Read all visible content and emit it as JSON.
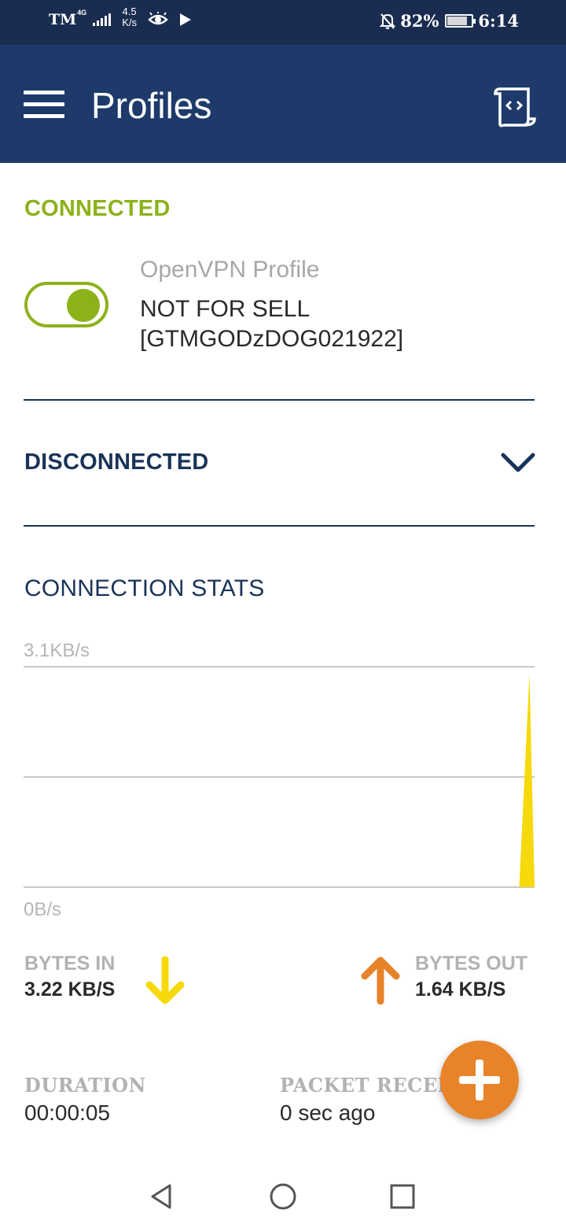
{
  "status_bar": {
    "carrier": "TM",
    "network_type": "4G",
    "net_speed_value": "4.5",
    "net_speed_unit": "K/s",
    "battery_percent": "82%",
    "battery_level": 0.82,
    "time": "6:14",
    "icons": [
      "signal-icon",
      "eye-icon",
      "play-icon",
      "bell-off-icon",
      "battery-icon"
    ]
  },
  "app_bar": {
    "title": "Profiles",
    "menu_icon": "hamburger-menu-icon",
    "action_icon": "import-file-icon",
    "background": "#1d3a6a"
  },
  "connected_section": {
    "label": "CONNECTED",
    "color": "#8cb21a",
    "toggle_on": true,
    "profile_type": "OpenVPN Profile",
    "profile_name": "NOT FOR SELL [GTMGODzDOG021922]"
  },
  "disconnected_section": {
    "label": "DISCONNECTED",
    "expand_icon": "chevron-down-icon"
  },
  "stats": {
    "title": "CONNECTION STATS",
    "bytes_in_label": "BYTES IN",
    "bytes_in_value": "3.22 KB/S",
    "bytes_out_label": "BYTES OUT",
    "bytes_out_value": "1.64 KB/S",
    "duration_label": "DURATION",
    "duration_value": "00:00:05",
    "packet_label": "PACKET RECEIVED",
    "packet_value": "0 sec ago",
    "in_color": "#f5d90a",
    "out_color": "#e8832a"
  },
  "chart_data": {
    "type": "area",
    "y_max_label": "3.1KB/s",
    "y_min_label": "0B/s",
    "ylim": [
      0,
      3.1
    ],
    "grid": true,
    "series": [
      {
        "color": "#f5d90a",
        "points": [
          [
            0,
            0
          ],
          [
            0.97,
            0
          ],
          [
            0.99,
            3.0
          ],
          [
            1.0,
            0
          ]
        ]
      }
    ]
  },
  "fab": {
    "icon": "plus-icon",
    "color": "#e8832a"
  },
  "nav_bar": {
    "icons": [
      "back-icon",
      "home-icon",
      "recents-icon"
    ]
  }
}
